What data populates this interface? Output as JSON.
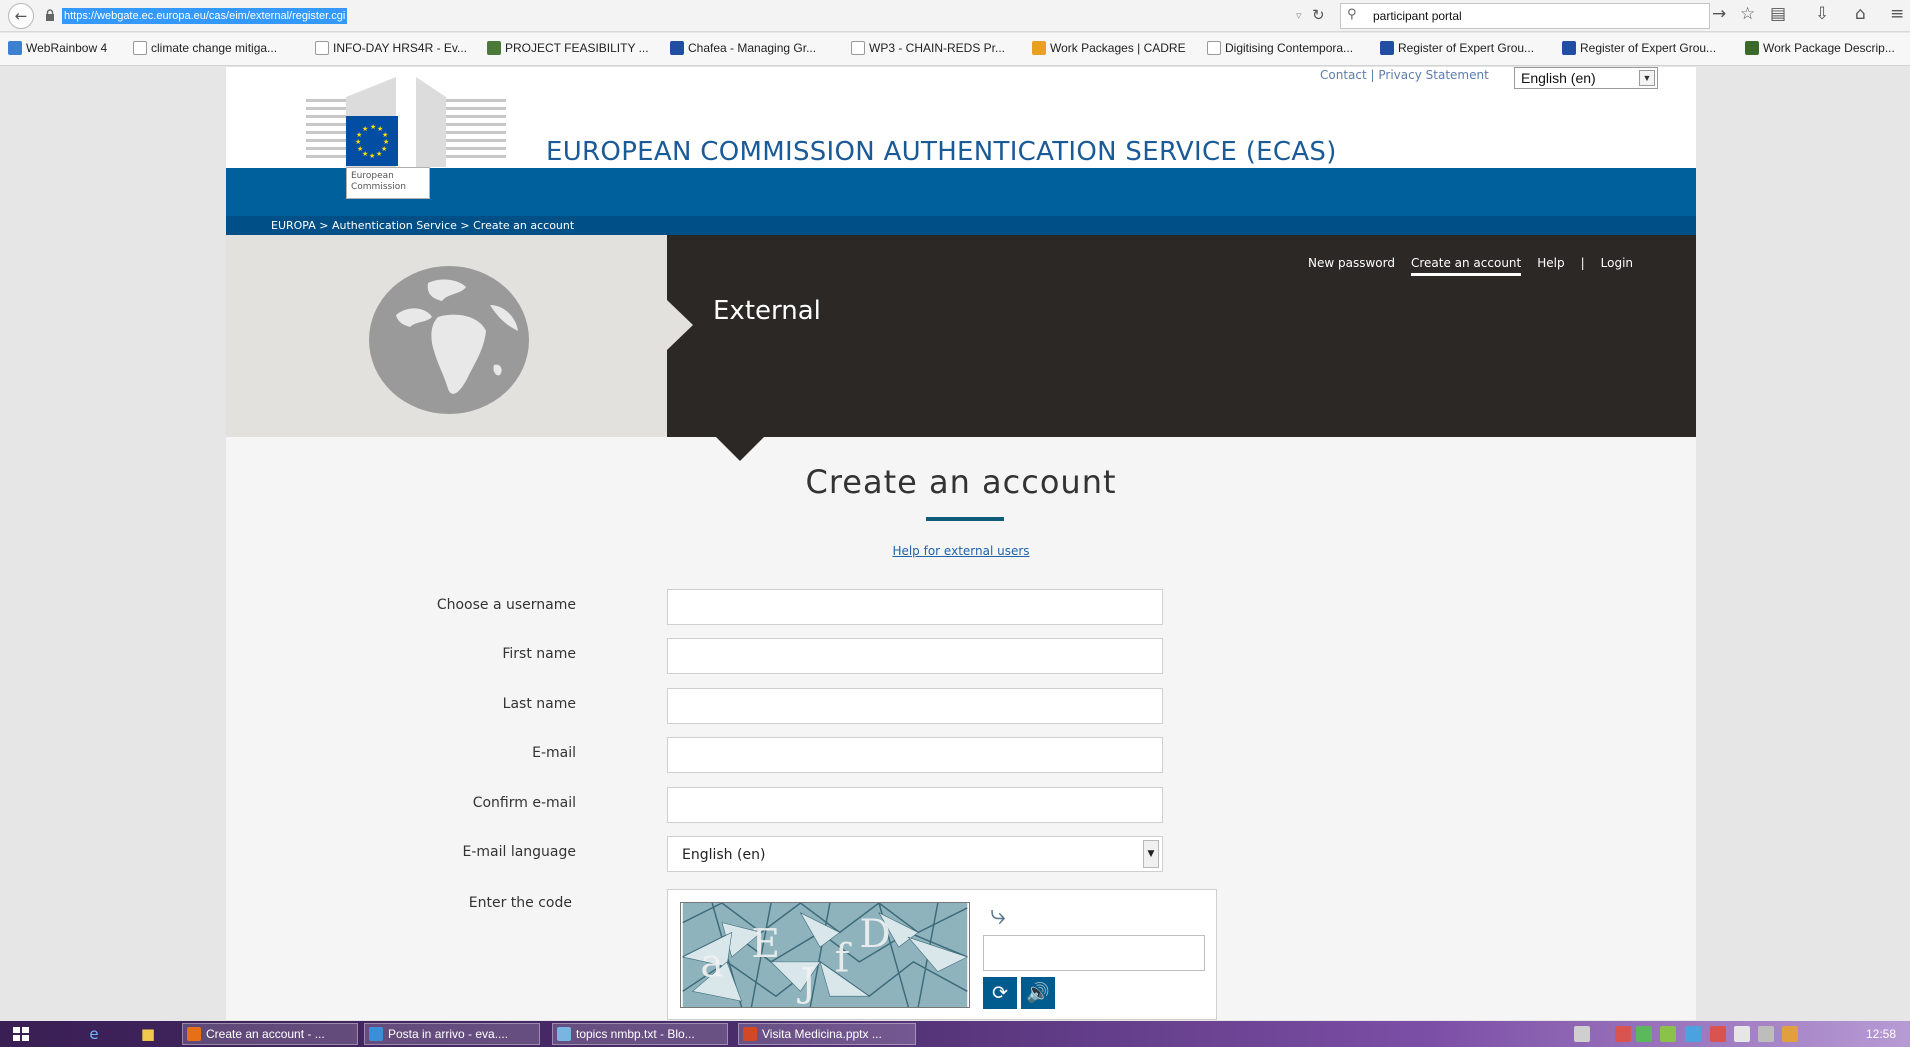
{
  "browser": {
    "url": "https://webgate.ec.europa.eu/cas/eim/external/register.cgi",
    "search_value": "participant portal"
  },
  "bookmarks": [
    {
      "label": "WebRainbow 4",
      "icon": "webrainbow-favicon",
      "color": "#3f7fd1"
    },
    {
      "label": "climate change mitiga...",
      "icon": "blank-page-icon",
      "color": "#ffffff"
    },
    {
      "label": "INFO-DAY HRS4R - Ev...",
      "icon": "blank-page-icon",
      "color": "#ffffff"
    },
    {
      "label": "PROJECT FEASIBILITY ...",
      "icon": "z-favicon",
      "color": "#4a7a3a"
    },
    {
      "label": "Chafea - Managing Gr...",
      "icon": "eu-favicon",
      "color": "#1f4ea2"
    },
    {
      "label": "WP3 - CHAIN-REDS Pr...",
      "icon": "blank-page-icon",
      "color": "#ffffff"
    },
    {
      "label": "Work Packages | CADRE",
      "icon": "cadre-favicon",
      "color": "#e8a020"
    },
    {
      "label": "Digitising Contempora...",
      "icon": "blank-page-icon",
      "color": "#ffffff"
    },
    {
      "label": "Register of Expert Grou...",
      "icon": "eu-favicon",
      "color": "#1f4ea2"
    },
    {
      "label": "Register of Expert Grou...",
      "icon": "eu-favicon",
      "color": "#1f4ea2"
    },
    {
      "label": "Work Package Descrip...",
      "icon": "wp-favicon",
      "color": "#3a6a2a"
    }
  ],
  "header": {
    "contact_link": "Contact",
    "separator": "|",
    "privacy_link": "Privacy Statement",
    "language": "English (en)",
    "logo_text_line1": "European",
    "logo_text_line2": "Commission",
    "service_title": "EUROPEAN COMMISSION AUTHENTICATION SERVICE (ECAS)"
  },
  "breadcrumb": {
    "items": [
      "EUROPA",
      "Authentication Service",
      "Create an account"
    ],
    "separator": ">"
  },
  "hero": {
    "label": "External",
    "nav": [
      "New password",
      "Create an account",
      "Help",
      "Login"
    ],
    "nav_separator": "|",
    "active_item": "Create an account"
  },
  "form": {
    "title": "Create an account",
    "help_link": "Help for external users",
    "fields": [
      {
        "label": "Choose a username",
        "value": ""
      },
      {
        "label": "First name",
        "value": ""
      },
      {
        "label": "Last name",
        "value": ""
      },
      {
        "label": "E-mail",
        "value": ""
      },
      {
        "label": "Confirm e-mail",
        "value": ""
      }
    ],
    "email_language_label": "E-mail language",
    "email_language_value": "English (en)",
    "code_label": "Enter the code"
  },
  "taskbar": {
    "tasks": [
      {
        "label": "Create an account - ...",
        "icon": "firefox-icon",
        "color": "#e76f16"
      },
      {
        "label": "Posta in arrivo - eva....",
        "icon": "chrome-icon",
        "color": "#3a8fd8"
      },
      {
        "label": "topics nmbp.txt - Blo...",
        "icon": "notepad-icon",
        "color": "#7ab4e0"
      },
      {
        "label": "Visita Medicina.pptx ...",
        "icon": "powerpoint-icon",
        "color": "#d24726"
      }
    ],
    "clock": "12:58"
  },
  "colors": {
    "brand_blue": "#00609c",
    "breadcrumb_blue": "#004f86",
    "hero_dark": "#2b2826",
    "link_blue": "#2263a8"
  }
}
